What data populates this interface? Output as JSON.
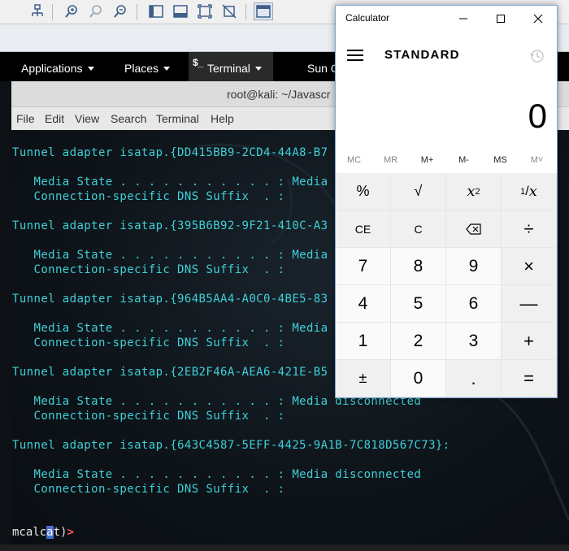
{
  "vm_toolbar": {
    "icons": [
      "network-icon",
      "zoom-in-icon",
      "zoom-reset-icon",
      "zoom-out-icon",
      "sidebar-icon",
      "window-icon",
      "fullscreen-icon",
      "no-fullscreen-icon",
      "console-icon"
    ]
  },
  "kali_panel": {
    "applications": "Applications",
    "places": "Places",
    "terminal_glyph": "$_",
    "terminal": "Terminal",
    "clock": "Sun C"
  },
  "terminal": {
    "title": "root@kali: ~/Javascr",
    "menu": [
      "File",
      "Edit",
      "View",
      "Search",
      "Terminal",
      "Help"
    ],
    "lines": [
      "Tunnel adapter isatap.{DD415BB9-2CD4-44A8-B7",
      "   Media State . . . . . . . . . . . : Media",
      "   Connection-specific DNS Suffix  . :",
      "Tunnel adapter isatap.{395B6B92-9F21-410C-A3",
      "   Media State . . . . . . . . . . . : Media",
      "   Connection-specific DNS Suffix  . :",
      "Tunnel adapter isatap.{964B5AA4-A0C0-4BE5-83",
      "   Media State . . . . . . . . . . . : Media",
      "   Connection-specific DNS Suffix  . :",
      "Tunnel adapter isatap.{2EB2F46A-AEA6-421E-B5",
      "   Media State . . . . . . . . . . . : Media disconnected",
      "   Connection-specific DNS Suffix  . :",
      "Tunnel adapter isatap.{643C4587-5EFF-4425-9A1B-7C818D567C73}:",
      "   Media State . . . . . . . . . . . : Media disconnected",
      "   Connection-specific DNS Suffix  . :"
    ],
    "prompt_pre": "mcalc",
    "prompt_cursor": "a",
    "prompt_post": "t",
    "prompt_paren": ")",
    "prompt_arrow": ">"
  },
  "calculator": {
    "app_title": "Calculator",
    "mode": "STANDARD",
    "display": "0",
    "memory": [
      "MC",
      "MR",
      "M+",
      "M-",
      "MS",
      "M˅"
    ],
    "keys": {
      "percent": "%",
      "sqrt": "√",
      "square_base": "x",
      "square_exp": "2",
      "recip_num": "1",
      "recip_den": "x",
      "ce": "CE",
      "c": "C",
      "divide": "÷",
      "seven": "7",
      "eight": "8",
      "nine": "9",
      "multiply": "×",
      "four": "4",
      "five": "5",
      "six": "6",
      "minus": "—",
      "one": "1",
      "two": "2",
      "three": "3",
      "plus": "+",
      "negate": "±",
      "zero": "0",
      "decimal": ".",
      "equals": "="
    }
  }
}
